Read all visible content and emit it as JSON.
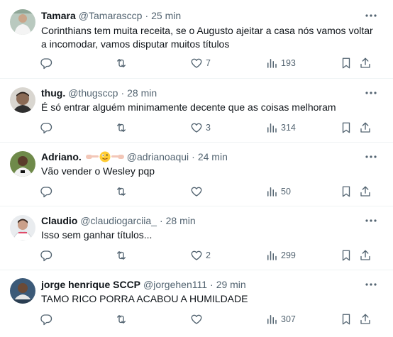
{
  "tweets": [
    {
      "name": "Tamara",
      "handle": "@Tamarasccp",
      "separator": "·",
      "time": "25 min",
      "text": "Corinthians tem muita receita, se o Augusto ajeitar a casa nós vamos voltar a incomodar, vamos disputar muitos títulos",
      "replies": "",
      "retweets": "",
      "likes": "7",
      "views": "193"
    },
    {
      "name": "thug.",
      "handle": "@thugsccp",
      "separator": "·",
      "time": "28 min",
      "text": "É só entrar alguém minimamente decente que as coisas melhoram",
      "replies": "",
      "retweets": "",
      "likes": "3",
      "views": "314"
    },
    {
      "name": "Adriano.",
      "handle": "@adrianoaqui",
      "separator": "·",
      "time": "24 min",
      "text": "Vão vender o Wesley pqp",
      "replies": "",
      "retweets": "",
      "likes": "",
      "views": "50",
      "name_emojis": [
        "hand-pointing-right-icon",
        "crazy-face-icon",
        "hand-pointing-left-icon"
      ]
    },
    {
      "name": "Claudio",
      "handle": "@claudiogarciia_",
      "separator": "·",
      "time": "28 min",
      "text": "Isso sem ganhar títulos...",
      "replies": "",
      "retweets": "",
      "likes": "2",
      "views": "299"
    },
    {
      "name": "jorge henrique SCCP",
      "handle": "@jorgehen111",
      "separator": "·",
      "time": "29 min",
      "text": "TAMO RICO PORRA ACABOU A HUMILDADE",
      "replies": "",
      "retweets": "",
      "likes": "",
      "views": "307"
    }
  ],
  "colors": {
    "text": "#0f1419",
    "secondary": "#536471",
    "divider": "#eff3f4"
  },
  "icons": [
    "reply-icon",
    "retweet-icon",
    "like-icon",
    "views-icon",
    "bookmark-icon",
    "share-icon",
    "more-icon"
  ]
}
